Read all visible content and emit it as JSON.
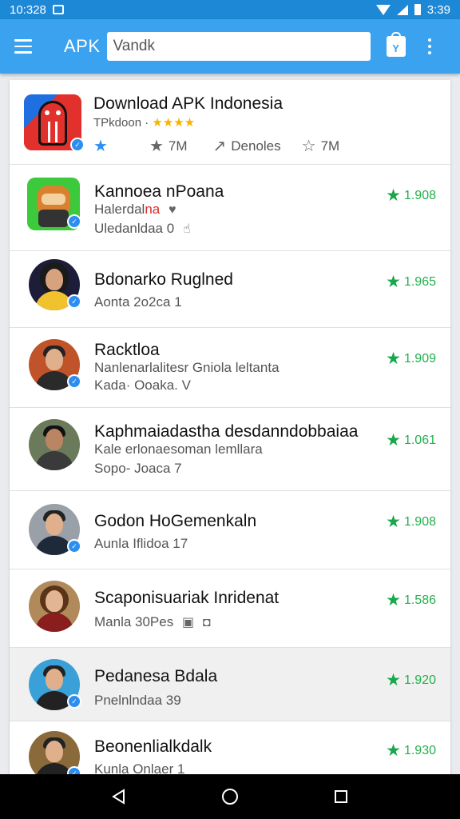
{
  "status_bar": {
    "time": "10:328",
    "right_time": "3:39"
  },
  "app_bar": {
    "title": "APK",
    "search_value": "Vandk"
  },
  "featured": {
    "title": "Download APK Indonesia",
    "subtitle": "TPkdoon",
    "stars": "★★★★",
    "meta_count_1": "7M",
    "meta_label": "Denoles",
    "meta_count_2": "7M"
  },
  "items": [
    {
      "title": "Kannoea nPoana",
      "line1_a": "Halerdal",
      "line1_b": "na",
      "line2": "Uledanldaa 0",
      "rating": "1.908"
    },
    {
      "title": "Bdonarko Ruglned",
      "line1_a": "Aonta 2o2ca 1",
      "line1_b": "",
      "line2": "",
      "rating": "1.965"
    },
    {
      "title": "Racktloa",
      "line1_a": "Nanlenarlalitesr Gniola leltanta",
      "line1_b": "",
      "line2": "Kada· Ooaka. V",
      "rating": "1.909"
    },
    {
      "title": "Kaphmaiadastha desdanndobbaiaa",
      "line1_a": "Kale erlonaesoman lemllara",
      "line1_b": "",
      "line2": "Sopo- Joaca 7",
      "rating": "1.061"
    },
    {
      "title": "Godon HoGemenkaln",
      "line1_a": "Aunla Iflidoa 17",
      "line1_b": "",
      "line2": "",
      "rating": "1.908"
    },
    {
      "title": "Scaponisuariak Inridenat",
      "line1_a": "Manla 30Pes",
      "line1_b": "",
      "line2": "",
      "rating": "1.586"
    },
    {
      "title": "Pedanesa Bdala",
      "line1_a": "Pnelnlndaa 39",
      "line1_b": "",
      "line2": "",
      "rating": "1.920"
    },
    {
      "title": "Beonenlialkdalk",
      "line1_a": "Kunla Onlaer 1",
      "line1_b": "",
      "line2": "",
      "rating": "1.930"
    }
  ],
  "colors": {
    "app_bar": "#3ba2f0",
    "status_bar": "#1d88d6",
    "rating_green": "#22b14c",
    "badge_blue": "#2b8ef0"
  }
}
